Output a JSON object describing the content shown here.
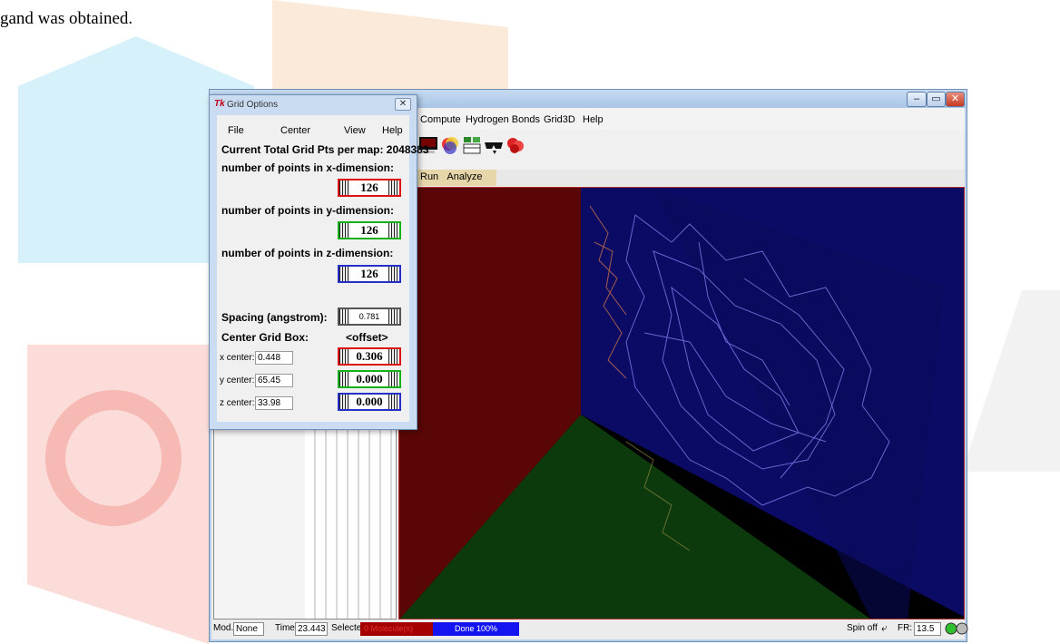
{
  "document": {
    "text": "gand was obtained."
  },
  "colors": {
    "x_axis": "#d11111",
    "y_axis": "#18b018",
    "z_axis": "#2530c8",
    "status_red": "#a50000",
    "status_blue": "#1414f0"
  },
  "app": {
    "window_controls": {
      "minimize": "–",
      "maximize": "▭",
      "close": "✕"
    },
    "menu": [
      "Compute",
      "Hydrogen Bonds",
      "Grid3D",
      "Help"
    ],
    "toolbar_icons": [
      "display-icon",
      "color-wheel-icon",
      "molecule-table-icon",
      "stereo-glasses-icon",
      "red-surface-icon"
    ],
    "tabs": [
      "Run",
      "Analyze"
    ],
    "status": {
      "mod_label": "Mod.:",
      "mod_value": "None",
      "time_label": "Time:",
      "time_value": "23.443",
      "selected_label": "Selected:",
      "selected_value": "0 Molecule(s)",
      "progress": "Done 100%",
      "spin_label": "Spin off",
      "fr_label": "FR:",
      "fr_value": "13.5"
    }
  },
  "dialog": {
    "title_icon": "Tk",
    "title": "Grid Options",
    "close": "✕",
    "menu": {
      "file": "File",
      "center": "Center",
      "view": "View",
      "help": "Help"
    },
    "total_grid": "Current Total Grid Pts per map:  2048383",
    "x_dim_label": "number of points in x-dimension:",
    "x_dim_value": "126",
    "y_dim_label": "number of points in y-dimension:",
    "y_dim_value": "126",
    "z_dim_label": "number of points in z-dimension:",
    "z_dim_value": "126",
    "spacing_label": "Spacing (angstrom):",
    "spacing_value": "0.781",
    "center_label": "Center Grid Box:",
    "offset_label": "<offset>",
    "x_center_label": "x center:",
    "x_center_value": "0.448",
    "x_offset": "0.306",
    "y_center_label": "y center:",
    "y_center_value": "65.45",
    "y_offset": "0.000",
    "z_center_label": "z center:",
    "z_center_value": "33.98",
    "z_offset": "0.000"
  }
}
